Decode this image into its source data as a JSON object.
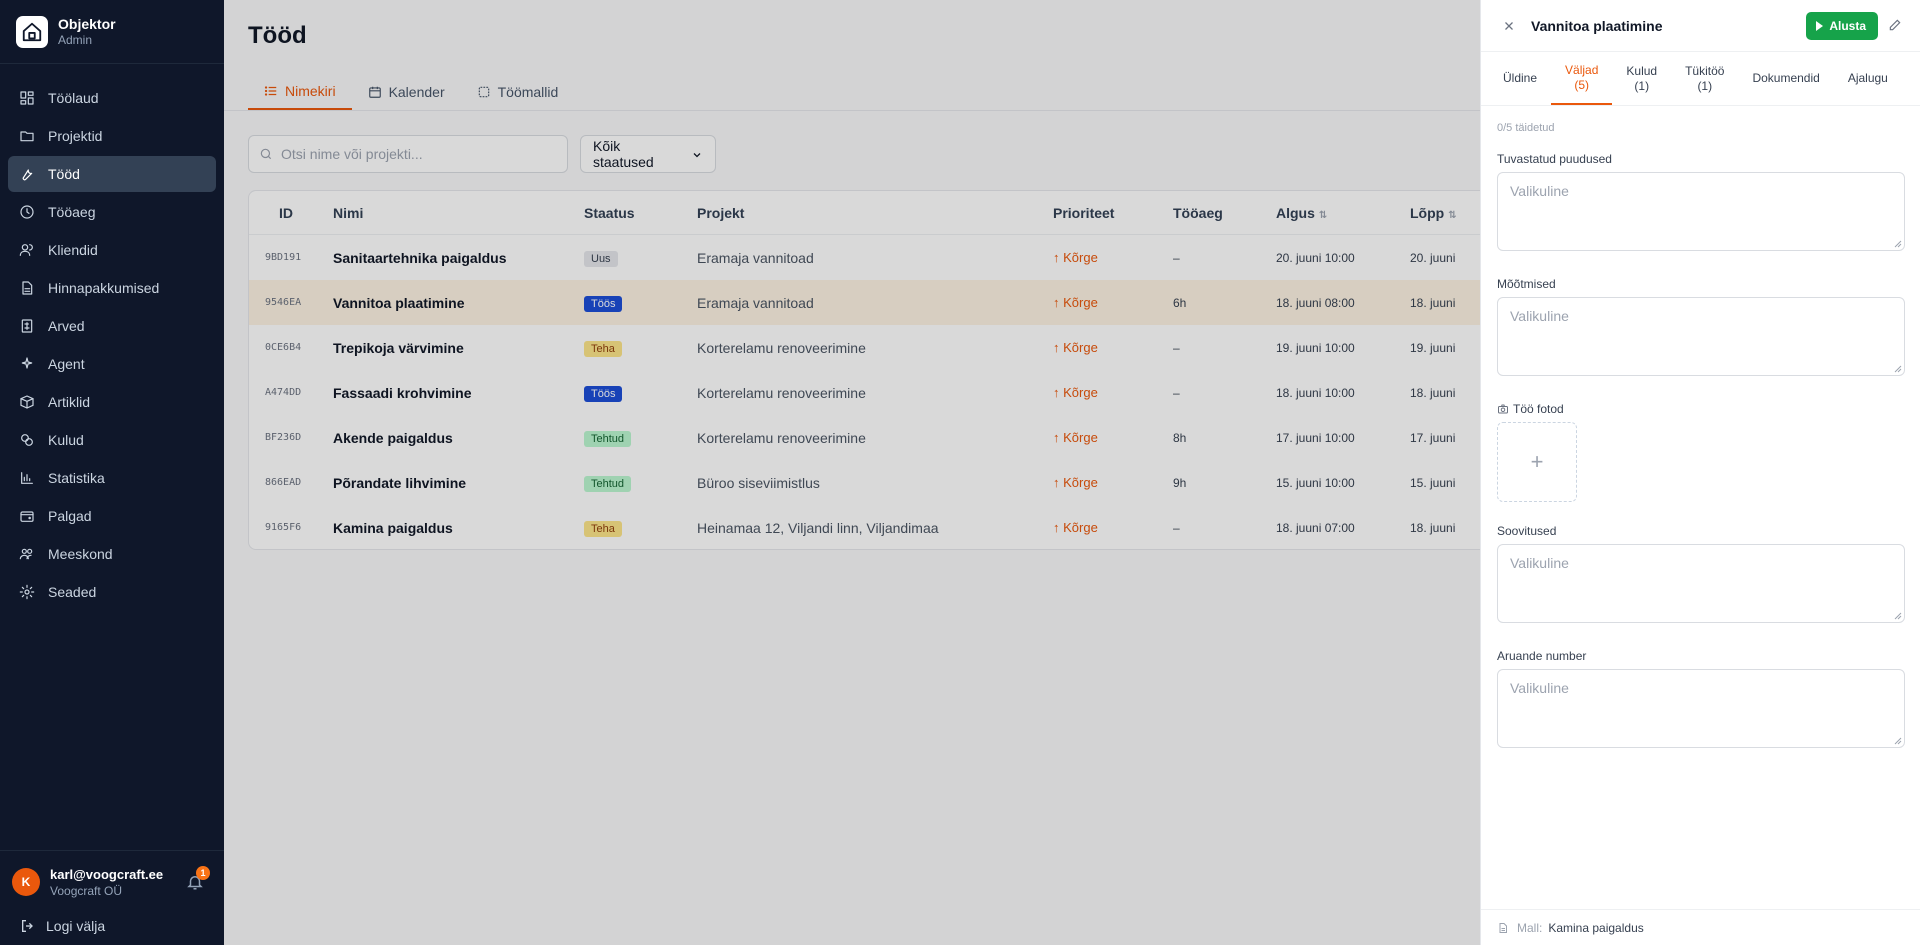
{
  "app": {
    "name": "Objektor",
    "role": "Admin"
  },
  "sidebar": {
    "items": [
      {
        "label": "Töölaud",
        "icon": "dashboard-icon"
      },
      {
        "label": "Projektid",
        "icon": "folder-icon"
      },
      {
        "label": "Tööd",
        "icon": "wrench-icon",
        "active": true
      },
      {
        "label": "Tööaeg",
        "icon": "clock-icon"
      },
      {
        "label": "Kliendid",
        "icon": "users-icon"
      },
      {
        "label": "Hinnapakkumised",
        "icon": "document-icon"
      },
      {
        "label": "Arved",
        "icon": "invoice-icon"
      },
      {
        "label": "Agent",
        "icon": "sparkle-icon"
      },
      {
        "label": "Artiklid",
        "icon": "box-icon"
      },
      {
        "label": "Kulud",
        "icon": "coins-icon"
      },
      {
        "label": "Statistika",
        "icon": "chart-icon"
      },
      {
        "label": "Palgad",
        "icon": "wallet-icon"
      },
      {
        "label": "Meeskond",
        "icon": "team-icon"
      },
      {
        "label": "Seaded",
        "icon": "gear-icon"
      }
    ],
    "user": {
      "initial": "K",
      "email": "karl@voogcraft.ee",
      "company": "Voogcraft OÜ",
      "notifications": "1"
    },
    "logout_label": "Logi välja"
  },
  "main": {
    "title": "Tööd",
    "tabs": [
      {
        "label": "Nimekiri",
        "icon": "list-icon",
        "active": true
      },
      {
        "label": "Kalender",
        "icon": "calendar-icon"
      },
      {
        "label": "Töömallid",
        "icon": "template-icon"
      }
    ],
    "search": {
      "placeholder": "Otsi nime või projekti..."
    },
    "status_filter": "Kõik staatused",
    "table": {
      "headers": {
        "id": "ID",
        "name": "Nimi",
        "status": "Staatus",
        "project": "Projekt",
        "priority": "Prioriteet",
        "time": "Tööaeg",
        "start": "Algus",
        "end": "Lõpp"
      },
      "rows": [
        {
          "id": "9BD191",
          "name": "Sanitaartehnika paigaldus",
          "status": "Uus",
          "status_kind": "uus",
          "project": "Eramaja vannitoad",
          "priority": "↑ Kõrge",
          "time": "–",
          "start": "20. juuni 10:00",
          "end": "20. juuni"
        },
        {
          "id": "9546EA",
          "name": "Vannitoa plaatimine",
          "status": "Töös",
          "status_kind": "toos",
          "project": "Eramaja vannitoad",
          "priority": "↑ Kõrge",
          "time": "6h",
          "start": "18. juuni 08:00",
          "end": "18. juuni"
        },
        {
          "id": "0CE6B4",
          "name": "Trepikoja värvimine",
          "status": "Teha",
          "status_kind": "teha",
          "project": "Korterelamu renoveerimine",
          "priority": "↑ Kõrge",
          "time": "–",
          "start": "19. juuni 10:00",
          "end": "19. juuni"
        },
        {
          "id": "A474DD",
          "name": "Fassaadi krohvimine",
          "status": "Töös",
          "status_kind": "toos",
          "project": "Korterelamu renoveerimine",
          "priority": "↑ Kõrge",
          "time": "–",
          "start": "18. juuni 10:00",
          "end": "18. juuni"
        },
        {
          "id": "BF236D",
          "name": "Akende paigaldus",
          "status": "Tehtud",
          "status_kind": "tehtud",
          "project": "Korterelamu renoveerimine",
          "priority": "↑ Kõrge",
          "time": "8h",
          "start": "17. juuni 10:00",
          "end": "17. juuni"
        },
        {
          "id": "866EAD",
          "name": "Põrandate lihvimine",
          "status": "Tehtud",
          "status_kind": "tehtud",
          "project": "Büroo siseviimistlus",
          "priority": "↑ Kõrge",
          "time": "9h",
          "start": "15. juuni 10:00",
          "end": "15. juuni"
        },
        {
          "id": "9165F6",
          "name": "Kamina paigaldus",
          "status": "Teha",
          "status_kind": "teha",
          "project": "Heinamaa 12, Viljandi linn, Viljandimaa",
          "priority": "↑ Kõrge",
          "time": "–",
          "start": "18. juuni 07:00",
          "end": "18. juuni"
        }
      ]
    }
  },
  "panel": {
    "title": "Vannitoa plaatimine",
    "start_label": "Alusta",
    "tabs": [
      {
        "line1": "Üldine",
        "line2": ""
      },
      {
        "line1": "Väljad",
        "line2": "(5)",
        "active": true
      },
      {
        "line1": "Kulud",
        "line2": "(1)"
      },
      {
        "line1": "Tükitöö",
        "line2": "(1)"
      },
      {
        "line1": "Dokumendid",
        "line2": ""
      },
      {
        "line1": "Ajalugu",
        "line2": ""
      }
    ],
    "progress": "0/5 täidetud",
    "fields": {
      "defects": {
        "label": "Tuvastatud puudused",
        "placeholder": "Valikuline"
      },
      "measurements": {
        "label": "Mõõtmised",
        "placeholder": "Valikuline"
      },
      "photos": {
        "label": "Töö fotod"
      },
      "recommendations": {
        "label": "Soovitused",
        "placeholder": "Valikuline"
      },
      "report_number": {
        "label": "Aruande number",
        "placeholder": "Valikuline"
      }
    },
    "footer": {
      "label": "Mall:",
      "value": "Kamina paigaldus"
    }
  },
  "colors": {
    "accent": "#ea580c",
    "sidebar_bg": "#0f172a",
    "start_green": "#16a34a",
    "toos_blue": "#1d4ed8"
  }
}
